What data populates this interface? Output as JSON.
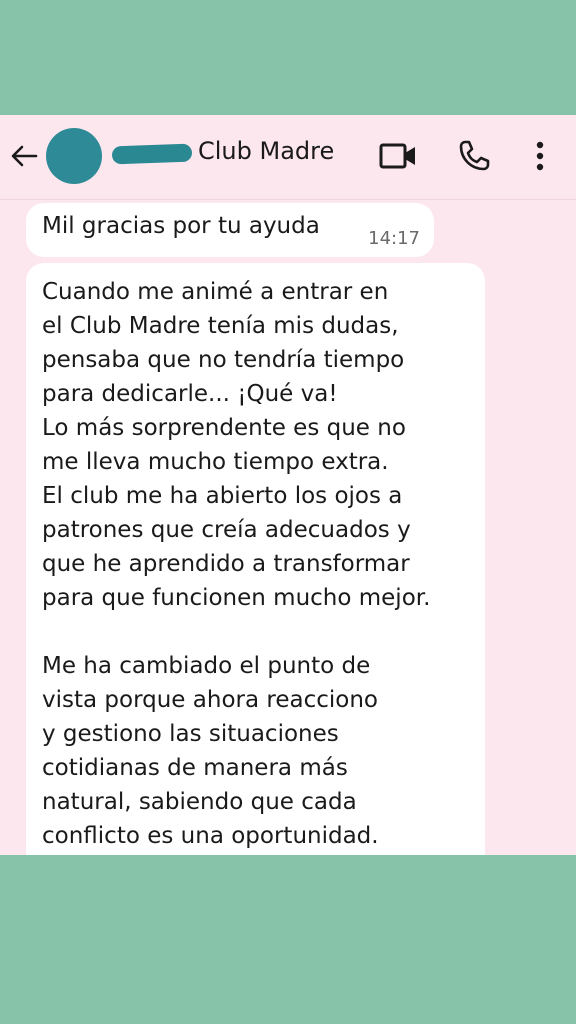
{
  "header": {
    "contact_name": "Club Madre",
    "icons": [
      "back-arrow-icon",
      "avatar",
      "video-call-icon",
      "phone-icon",
      "more-vert-icon"
    ]
  },
  "messages": [
    {
      "text": "Mil gracias por tu ayuda",
      "time": "14:17"
    },
    {
      "text": "Cuando me animé a entrar en\nel Club Madre tenía mis dudas,\npensaba que no tendría tiempo\npara dedicarle... ¡Qué va!\nLo más sorprendente es que no\nme lleva mucho tiempo extra.\nEl club me ha abierto los ojos a\npatrones que creía adecuados y\nque he aprendido a transformar\npara que funcionen mucho mejor.\n\nMe ha cambiado el punto de\nvista porque ahora reacciono\ny gestiono las situaciones\ncotidianas de manera más\nnatural, sabiendo que cada\nconflicto es una oportunidad."
    }
  ],
  "colors": {
    "outer_background": "#86c3a8",
    "chat_background": "#fde7ef",
    "bubble": "#ffffff",
    "redaction": "#2e8a96"
  }
}
